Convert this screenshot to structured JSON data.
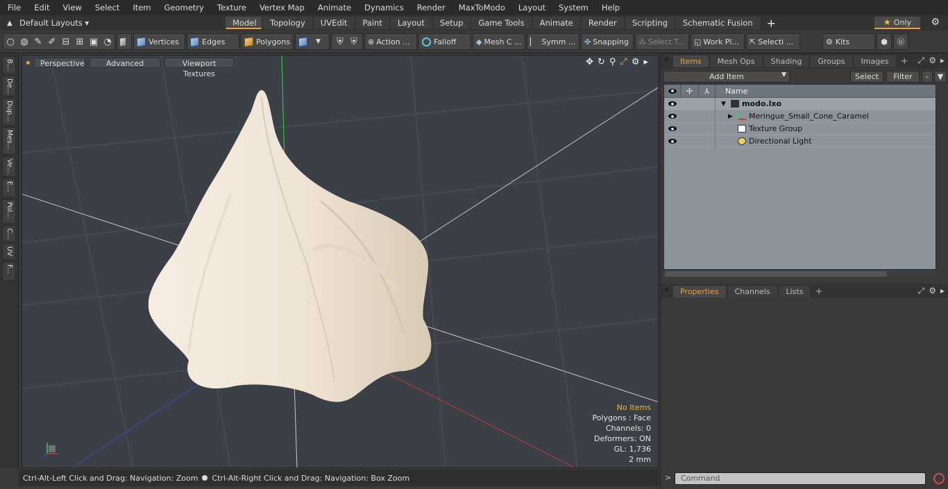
{
  "menu": [
    "File",
    "Edit",
    "View",
    "Select",
    "Item",
    "Geometry",
    "Texture",
    "Vertex Map",
    "Animate",
    "Dynamics",
    "Render",
    "MaxToModo",
    "Layout",
    "System",
    "Help"
  ],
  "layouts": {
    "selector": "Default Layouts",
    "tabs": [
      "Model",
      "Topology",
      "UVEdit",
      "Paint",
      "Layout",
      "Setup",
      "Game Tools",
      "Animate",
      "Render",
      "Scripting",
      "Schematic Fusion"
    ],
    "active": "Model",
    "only_label": "Only"
  },
  "toolbar": {
    "vertices": "Vertices",
    "edges": "Edges",
    "polygons": "Polygons",
    "action": "Action ...",
    "falloff": "Falloff",
    "mesh": "Mesh C ...",
    "symmetry": "Symm ...",
    "snapping": "Snapping",
    "select_t": "Select T...",
    "work_plane": "Work Pl...",
    "selection": "Selecti ...",
    "kits": "Kits"
  },
  "left_tabs": [
    "B...",
    "De...",
    "Dup...",
    "Mes...",
    "Ve...",
    "E...",
    "Pol...",
    "C...",
    "UV",
    "F..."
  ],
  "viewport": {
    "perspective": "Perspective",
    "advanced": "Advanced",
    "textures": "Viewport Textures",
    "info": {
      "selection": "No Items",
      "polygons": "Polygons : Face",
      "channels": "Channels: 0",
      "deformers": "Deformers: ON",
      "gl": "GL: 1,736",
      "scale": "2 mm"
    },
    "colors": {
      "background": "#3b4046",
      "mesh": "#efe3d3",
      "x_axis": "#c43b3b",
      "y_axis": "#3bd14a",
      "z_axis": "#3b4ec4"
    }
  },
  "status": {
    "left": "Ctrl-Alt-Left Click and Drag: Navigation: Zoom",
    "right": "Ctrl-Alt-Right Click and Drag: Navigation: Box Zoom"
  },
  "items_panel": {
    "tabs": [
      "Items",
      "Mesh Ops",
      "Shading",
      "Groups",
      "Images"
    ],
    "active": "Items",
    "add_item": "Add Item",
    "select": "Select",
    "filter": "Filter",
    "column_name": "Name",
    "rows": [
      {
        "name": "modo.lxo",
        "icon": "scene-icon"
      },
      {
        "name": "Meringue_Small_Cone_Caramel",
        "icon": "mesh-icon"
      },
      {
        "name": "Texture Group",
        "icon": "texture-group-icon"
      },
      {
        "name": "Directional Light",
        "icon": "light-icon"
      }
    ]
  },
  "properties_panel": {
    "tabs": [
      "Properties",
      "Channels",
      "Lists"
    ],
    "active": "Properties"
  },
  "command": {
    "placeholder": "Command"
  }
}
